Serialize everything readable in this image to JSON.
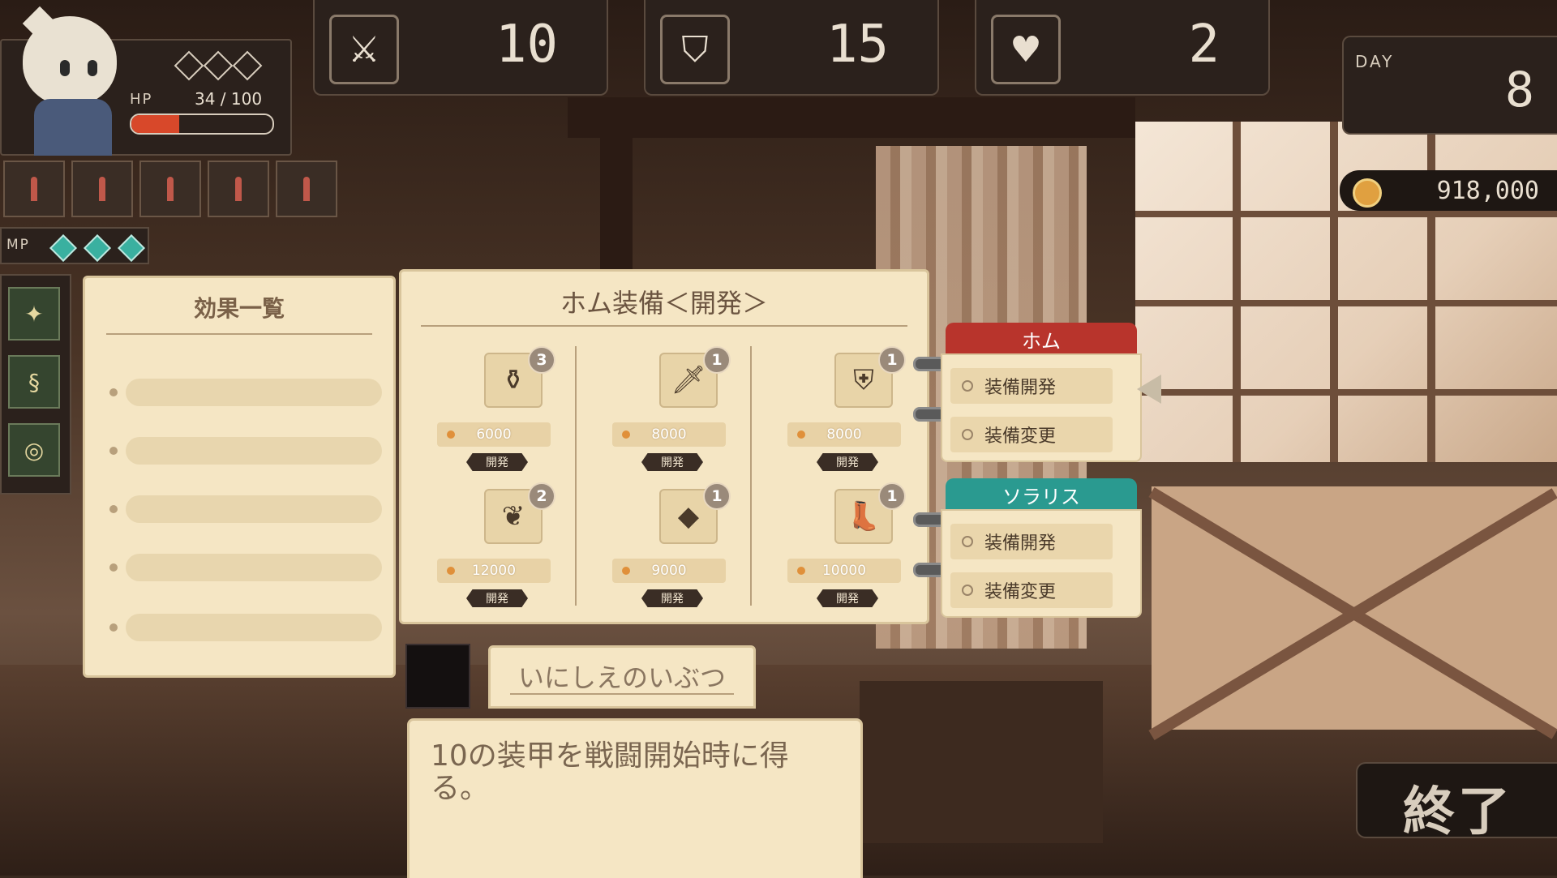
{
  "player": {
    "hp_label": "HP",
    "hp_text": "34 / 100",
    "hp_fraction": 0.34,
    "mp_label": "MP"
  },
  "stats": {
    "attack": {
      "icon": "sword-icon",
      "value": "10"
    },
    "defense": {
      "icon": "shield-icon",
      "value": "15"
    },
    "heart": {
      "icon": "heart-icon",
      "value": "2"
    }
  },
  "day": {
    "label": "DAY",
    "value": "8"
  },
  "gold": {
    "value": "918,000"
  },
  "effects_panel": {
    "title": "効果一覧"
  },
  "dev_panel": {
    "title": "ホム装備＜開発＞",
    "items": [
      {
        "icon": "potion-icon",
        "count": "3",
        "price": "6000",
        "button": "開発"
      },
      {
        "icon": "dagger-icon",
        "count": "1",
        "price": "8000",
        "button": "開発"
      },
      {
        "icon": "armor-icon",
        "count": "1",
        "price": "8000",
        "button": "開発"
      },
      {
        "icon": "feather-icon",
        "count": "2",
        "price": "12000",
        "button": "開発"
      },
      {
        "icon": "crystal-icon",
        "count": "1",
        "price": "9000",
        "button": "開発"
      },
      {
        "icon": "boot-icon",
        "count": "1",
        "price": "10000",
        "button": "開発"
      }
    ]
  },
  "tabs": [
    {
      "name": "ホム",
      "color": "#b8342c",
      "buttons": [
        "装備開発",
        "装備変更"
      ]
    },
    {
      "name": "ソラリス",
      "color": "#2a9a90",
      "buttons": [
        "装備開発",
        "装備変更"
      ]
    }
  ],
  "selected_item": {
    "name": "いにしえのいぶつ",
    "description": "10の装甲を戦闘開始時に得る。"
  },
  "end_button": {
    "label": "終了"
  }
}
